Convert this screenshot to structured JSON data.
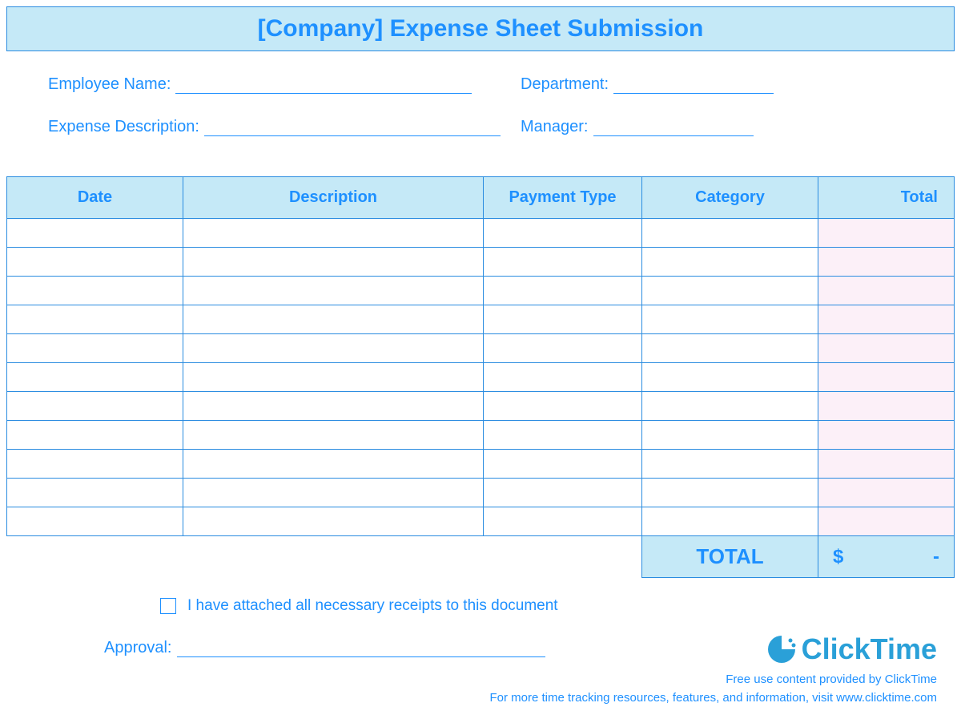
{
  "title": "[Company] Expense Sheet Submission",
  "info": {
    "employee_name_label": "Employee Name:",
    "department_label": "Department:",
    "expense_description_label": "Expense Description:",
    "manager_label": "Manager:"
  },
  "table": {
    "headers": {
      "date": "Date",
      "description": "Description",
      "payment_type": "Payment Type",
      "category": "Category",
      "total": "Total"
    },
    "rows_count": 11
  },
  "grand_total": {
    "label": "TOTAL",
    "currency": "$",
    "value": "-"
  },
  "checkbox": {
    "label": "I have attached all necessary receipts to this document"
  },
  "approval": {
    "label": "Approval:"
  },
  "footer": {
    "logo_text": "ClickTime",
    "line1": "Free use content provided by ClickTime",
    "line2": "For more time tracking resources, features, and information, visit www.clicktime.com"
  }
}
